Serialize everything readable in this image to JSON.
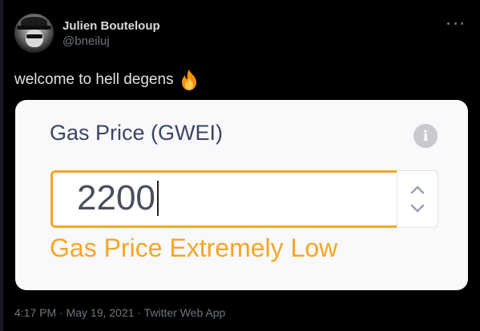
{
  "tweet": {
    "author": {
      "display_name": "Julien Bouteloup",
      "handle": "@bneiluj"
    },
    "text": "welcome to hell degens",
    "emoji": "fire-icon",
    "meta": "4:17 PM · May 19, 2021 · Twitter Web App"
  },
  "gas_card": {
    "label": "Gas Price (GWEI)",
    "value": "2200",
    "warning": "Gas Price Extremely Low",
    "info_icon_glyph": "i"
  },
  "colors": {
    "background": "#000000",
    "text_primary": "#d9d9d9",
    "text_secondary": "#6e767d",
    "card_background": "#f9f9fb",
    "label_color": "#3c4463",
    "warning_accent": "#f5a623"
  }
}
